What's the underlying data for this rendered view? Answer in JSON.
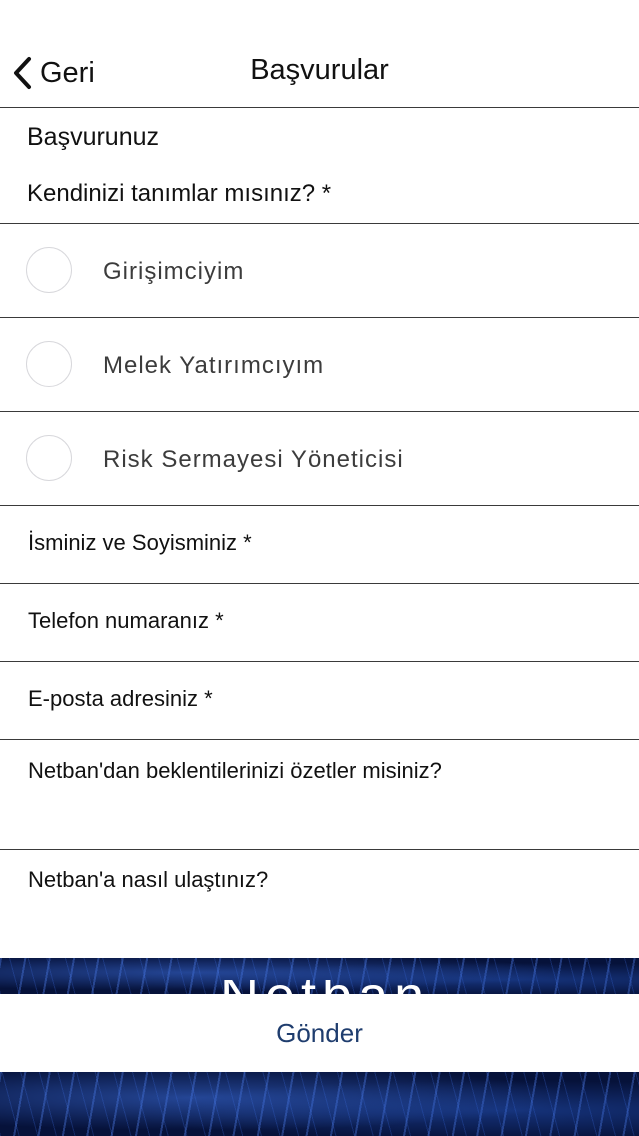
{
  "nav": {
    "back_label": "Geri",
    "title": "Başvurular"
  },
  "form": {
    "section_title": "Başvurunuz",
    "question": "Kendinizi tanımlar mısınız? *",
    "options": [
      {
        "label": "Girişimciyim",
        "selected": false
      },
      {
        "label": "Melek Yatırımcıyım",
        "selected": false
      },
      {
        "label": "Risk Sermayesi Yöneticisi",
        "selected": false
      }
    ],
    "fields": {
      "name": "İsminiz ve Soyisminiz *",
      "phone": "Telefon numaranız *",
      "email": "E-posta adresiniz *",
      "expectations": "Netban'dan beklentilerinizi özetler misiniz?",
      "source": "Netban'a nasıl ulaştınız?"
    },
    "submit_label": "Gönder"
  },
  "colors": {
    "submit_text": "#1f3d6e",
    "background_dark": "#06123a",
    "divider": "#3a3a3a"
  },
  "icons": {
    "back": "chevron-left-icon",
    "radio": "radio-circle-icon"
  }
}
